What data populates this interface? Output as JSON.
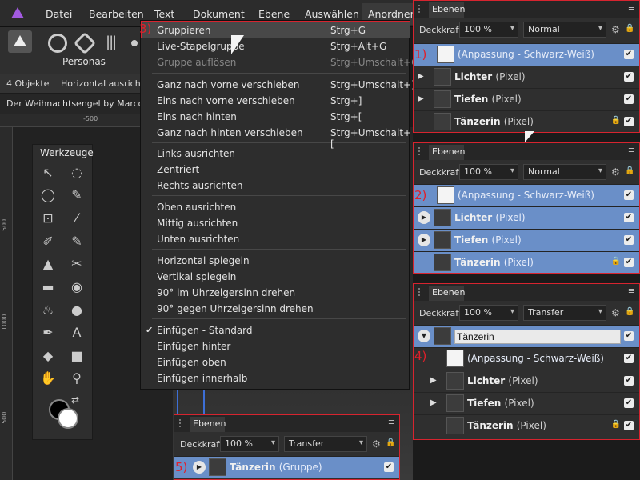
{
  "menubar": {
    "items": [
      "Datei",
      "Bearbeiten",
      "Text",
      "Dokument",
      "Ebene",
      "Auswählen",
      "Anordnen"
    ]
  },
  "personas": {
    "label": "Personas"
  },
  "context_toolbar": {
    "selection": "4 Objekte",
    "align": "Horizontal ausricht"
  },
  "document": {
    "tab": "Der Weihnachtsengel by Marco Kc"
  },
  "ruler": {
    "h_tick": "-500",
    "v_ticks": [
      "500",
      "1000",
      "1500"
    ]
  },
  "tools": {
    "title": "Werkzeuge"
  },
  "menu": {
    "step_label": "3)",
    "items": [
      {
        "label": "Gruppieren",
        "shortcut": "Strg+G",
        "state": "hover"
      },
      {
        "label": "Live-Stapelgruppe",
        "shortcut": "Strg+Alt+G"
      },
      {
        "label": "Gruppe auflösen",
        "shortcut": "Strg+Umschalt+G",
        "state": "disabled"
      },
      {
        "label": "Ganz nach vorne verschieben",
        "shortcut": "Strg+Umschalt+]"
      },
      {
        "label": "Eins nach vorne verschieben",
        "shortcut": "Strg+]"
      },
      {
        "label": "Eins nach hinten",
        "shortcut": "Strg+["
      },
      {
        "label": "Ganz nach hinten verschieben",
        "shortcut": "Strg+Umschalt+["
      },
      {
        "label": "Links ausrichten"
      },
      {
        "label": "Zentriert"
      },
      {
        "label": "Rechts ausrichten"
      },
      {
        "label": "Oben ausrichten"
      },
      {
        "label": "Mittig ausrichten"
      },
      {
        "label": "Unten ausrichten"
      },
      {
        "label": "Horizontal spiegeln"
      },
      {
        "label": "Vertikal spiegeln"
      },
      {
        "label": "90° im Uhrzeigersinn drehen"
      },
      {
        "label": "90° gegen Uhrzeigersinn drehen"
      },
      {
        "label": "Einfügen - Standard",
        "checked": "✔"
      },
      {
        "label": "Einfügen hinter"
      },
      {
        "label": "Einfügen oben"
      },
      {
        "label": "Einfügen innerhalb"
      }
    ]
  },
  "panels": [
    {
      "title": "Ebenen",
      "opacity_label": "Deckkraft:",
      "opacity": "100 %",
      "blend": "Normal",
      "layers": [
        {
          "step": "1)",
          "name": "(Anpassung - Schwarz-Weiß)",
          "type": "",
          "selected": true,
          "adjust": true
        },
        {
          "name": "Lichter",
          "type": "(Pixel)",
          "tri": "▶"
        },
        {
          "name": "Tiefen",
          "type": "(Pixel)",
          "tri": "▶"
        },
        {
          "name": "Tänzerin",
          "type": "(Pixel)",
          "lock": true
        }
      ]
    },
    {
      "title": "Ebenen",
      "opacity_label": "Deckkraft:",
      "opacity": "100 %",
      "blend": "Normal",
      "layers": [
        {
          "step": "2)",
          "name": "(Anpassung - Schwarz-Weiß)",
          "type": "",
          "selected": true,
          "adjust": true
        },
        {
          "name": "Lichter",
          "type": "(Pixel)",
          "tri": "▶",
          "selected": true,
          "circle": true
        },
        {
          "name": "Tiefen",
          "type": "(Pixel)",
          "tri": "▶",
          "selected": true,
          "circle": true
        },
        {
          "name": "Tänzerin",
          "type": "(Pixel)",
          "lock": true,
          "selected": true
        }
      ]
    },
    {
      "title": "Ebenen",
      "opacity_label": "Deckkraft:",
      "opacity": "100 %",
      "blend": "Transfer",
      "group_name_value": "Tänzerin",
      "step": "4)",
      "layers": [
        {
          "name": "(Anpassung - Schwarz-Weiß)",
          "type": "",
          "adjust": true
        },
        {
          "name": "Lichter",
          "type": "(Pixel)",
          "tri": "▶"
        },
        {
          "name": "Tiefen",
          "type": "(Pixel)",
          "tri": "▶"
        },
        {
          "name": "Tänzerin",
          "type": "(Pixel)",
          "lock": true
        }
      ]
    },
    {
      "title": "Ebenen",
      "opacity_label": "Deckkraft:",
      "opacity": "100 %",
      "blend": "Transfer",
      "layers": [
        {
          "step": "5)",
          "name": "Tänzerin",
          "type": "(Gruppe)",
          "selected": true,
          "circle": true,
          "tri": "▶"
        }
      ]
    }
  ],
  "colors": {
    "accent": "#6a8fc8",
    "step_red": "#e01f2a",
    "menu_bg": "#2d2d2d"
  }
}
